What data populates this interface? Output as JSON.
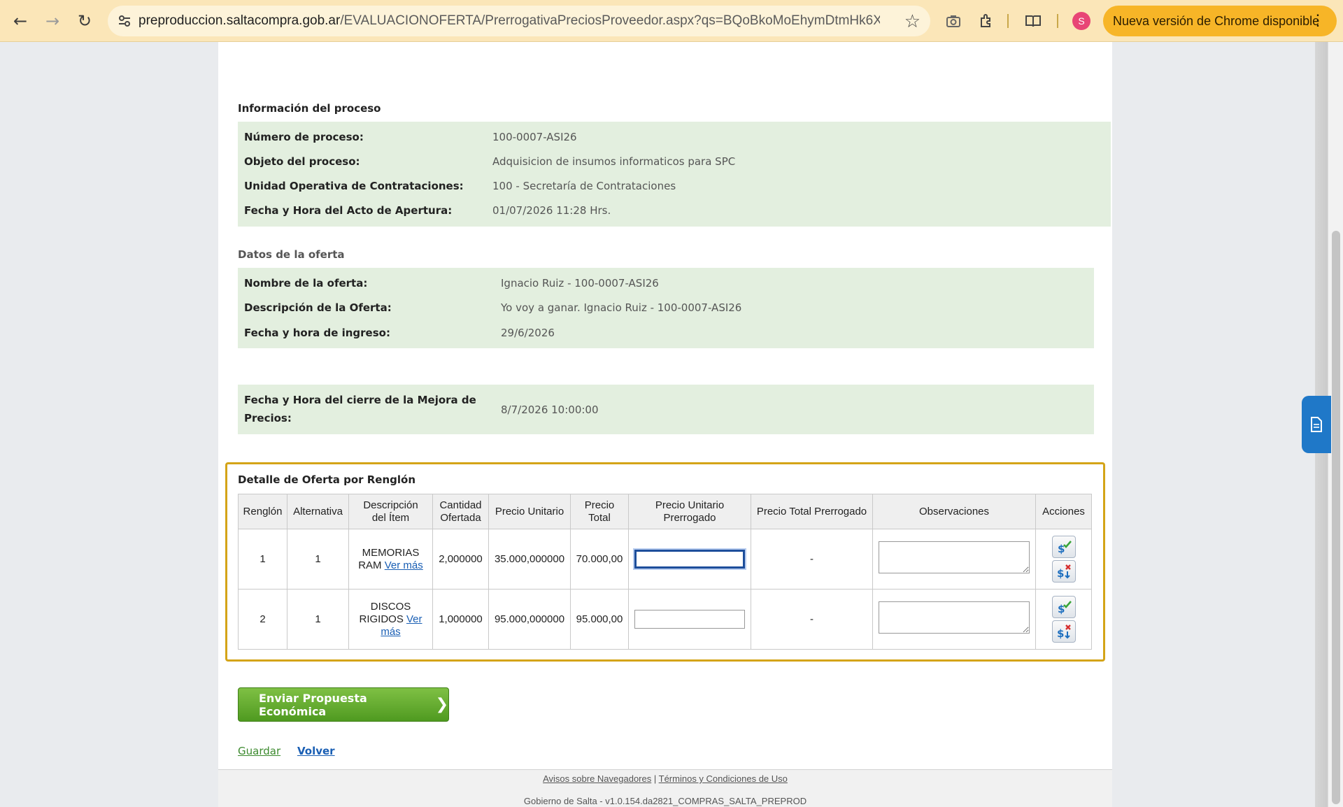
{
  "browser": {
    "url_host": "preproduccion.saltacompra.gob.ar",
    "url_path": "/EVALUACIONOFERTA/PrerrogativaPreciosProveedor.aspx?qs=BQoBkoMoEhymDtmHk6XJP...",
    "avatar_initial": "S",
    "update_label": "Nueva versión de Chrome disponible",
    "accent_color": "#f7b527"
  },
  "proceso": {
    "section_title": "Información del proceso",
    "rows": [
      {
        "label": "Número de proceso:",
        "value": "100-0007-ASI26"
      },
      {
        "label": "Objeto del proceso:",
        "value": "Adquisicion de insumos informaticos para SPC"
      },
      {
        "label": "Unidad Operativa de Contrataciones:",
        "value": "100 - Secretaría de Contrataciones"
      },
      {
        "label": "Fecha y Hora del Acto de Apertura:",
        "value": "01/07/2026 11:28 Hrs."
      }
    ]
  },
  "oferta": {
    "section_title": "Datos de la oferta",
    "rows": [
      {
        "label": "Nombre de la oferta:",
        "value": "Ignacio Ruiz - 100-0007-ASI26"
      },
      {
        "label": "Descripción de la Oferta:",
        "value": "Yo voy a ganar. Ignacio Ruiz - 100-0007-ASI26"
      },
      {
        "label": "Fecha y hora de ingreso:",
        "value": "29/6/2026"
      }
    ]
  },
  "cierre": {
    "label_line1": "Fecha y Hora del cierre de la Mejora de",
    "label_line2": "Precios:",
    "value": "8/7/2026 10:00:00"
  },
  "detalle": {
    "title": "Detalle de Oferta por Renglón",
    "headers": {
      "renglon": "Renglón",
      "alternativa": "Alternativa",
      "descripcion_1": "Descripción",
      "descripcion_2": "del Ítem",
      "cantidad_1": "Cantidad",
      "cantidad_2": "Ofertada",
      "precio_unitario": "Precio Unitario",
      "precio_total_1": "Precio",
      "precio_total_2": "Total",
      "pu_prerrogado_1": "Precio Unitario",
      "pu_prerrogado_2": "Prerrogado",
      "pt_prerrogado": "Precio Total Prerrogado",
      "observaciones": "Observaciones",
      "acciones": "Acciones"
    },
    "rows": [
      {
        "renglon": "1",
        "alternativa": "1",
        "desc_1": "MEMORIAS",
        "desc_2": "RAM",
        "ver_mas": "Ver más",
        "cantidad": "2,000000",
        "precio_unitario": "35.000,000000",
        "precio_total": "70.000,00",
        "precio_unitario_prerrogado": "",
        "precio_total_prerrogado": "-",
        "observaciones": ""
      },
      {
        "renglon": "2",
        "alternativa": "1",
        "desc_1": "DISCOS",
        "desc_2": "RIGIDOS",
        "ver_mas_1": "Ver",
        "ver_mas_2": "más",
        "cantidad": "1,000000",
        "precio_unitario": "95.000,000000",
        "precio_total": "95.000,00",
        "precio_unitario_prerrogado": "",
        "precio_total_prerrogado": "-",
        "observaciones": ""
      }
    ]
  },
  "actions": {
    "send_label": "Enviar Propuesta Económica",
    "save_label": "Guardar",
    "back_label": "Volver"
  },
  "footer": {
    "link_browsers": "Avisos sobre Navegadores",
    "separator": "|",
    "link_terms": "Términos y Condiciones de Uso",
    "version": "Gobierno de Salta - v1.0.154.da2821_COMPRAS_SALTA_PREPROD"
  }
}
